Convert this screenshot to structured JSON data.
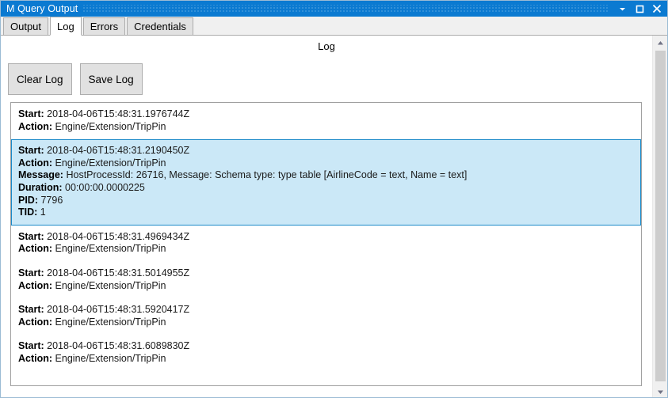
{
  "window": {
    "title": "M Query Output",
    "controls": [
      {
        "name": "minimize",
        "glyph": "chevron-down"
      },
      {
        "name": "maximize",
        "glyph": "square"
      },
      {
        "name": "close",
        "glyph": "x"
      }
    ],
    "titlebar_color": "#0b7ad1"
  },
  "tabs": [
    {
      "label": "Output",
      "active": false
    },
    {
      "label": "Log",
      "active": true
    },
    {
      "label": "Errors",
      "active": false
    },
    {
      "label": "Credentials",
      "active": false
    }
  ],
  "panel": {
    "title": "Log"
  },
  "toolbar": {
    "clear_label": "Clear Log",
    "save_label": "Save Log"
  },
  "labels": {
    "start": "Start:",
    "action": "Action:",
    "message": "Message:",
    "duration": "Duration:",
    "pid": "PID:",
    "tid": "TID:"
  },
  "selection_color": "#cbe8f7",
  "selection_border_color": "#1a8ac9",
  "log_entries": [
    {
      "selected": false,
      "start": "2018-04-06T15:48:31.1976744Z",
      "action": "Engine/Extension/TripPin"
    },
    {
      "selected": true,
      "start": "2018-04-06T15:48:31.2190450Z",
      "action": "Engine/Extension/TripPin",
      "message": "HostProcessId: 26716, Message: Schema type: type table [AirlineCode = text, Name = text]",
      "duration": "00:00:00.0000225",
      "pid": "7796",
      "tid": "1"
    },
    {
      "selected": false,
      "start": "2018-04-06T15:48:31.4969434Z",
      "action": "Engine/Extension/TripPin"
    },
    {
      "selected": false,
      "start": "2018-04-06T15:48:31.5014955Z",
      "action": "Engine/Extension/TripPin"
    },
    {
      "selected": false,
      "start": "2018-04-06T15:48:31.5920417Z",
      "action": "Engine/Extension/TripPin"
    },
    {
      "selected": false,
      "start": "2018-04-06T15:48:31.6089830Z",
      "action": "Engine/Extension/TripPin"
    }
  ]
}
